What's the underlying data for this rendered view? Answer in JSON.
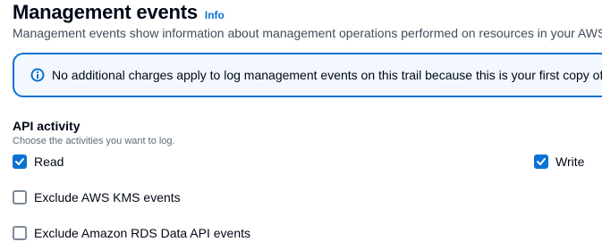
{
  "header": {
    "title": "Management events",
    "info_label": "Info"
  },
  "description": "Management events show information about management operations performed on resources in your AWS account.",
  "alert": {
    "icon": "info-circle-icon",
    "text": "No additional charges apply to log management events on this trail because this is your first copy of management events."
  },
  "api_activity": {
    "label": "API activity",
    "description": "Choose the activities you want to log.",
    "read_label": "Read",
    "read_checked": true,
    "write_label": "Write",
    "write_checked": true
  },
  "exclusions": {
    "kms_label": "Exclude AWS KMS events",
    "kms_checked": false,
    "rds_label": "Exclude Amazon RDS Data API events",
    "rds_checked": false
  },
  "colors": {
    "accent": "#0972d3",
    "alert_background": "#f2f8fd",
    "checkbox_border": "#7d8998"
  }
}
